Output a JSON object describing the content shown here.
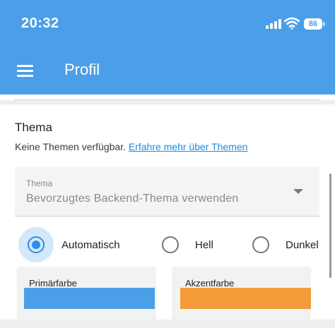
{
  "status_bar": {
    "time": "20:32",
    "battery": "86"
  },
  "toolbar": {
    "title": "Profil"
  },
  "theme_card": {
    "title": "Thema",
    "description": "Keine Themen verfügbar. ",
    "link_text": "Erfahre mehr über Themen",
    "select": {
      "label": "Thema",
      "value": "Bevorzugtes Backend-Thema verwenden"
    },
    "radio_options": [
      {
        "label": "Automatisch",
        "checked": true
      },
      {
        "label": "Hell",
        "checked": false
      },
      {
        "label": "Dunkel",
        "checked": false
      }
    ],
    "colors": [
      {
        "label": "Primärfarbe",
        "value": "#4a9fe8"
      },
      {
        "label": "Akzentfarbe",
        "value": "#f29b38"
      }
    ]
  },
  "icons": {
    "menu": "hamburger-menu-icon",
    "dropdown": "dropdown-arrow-icon"
  }
}
